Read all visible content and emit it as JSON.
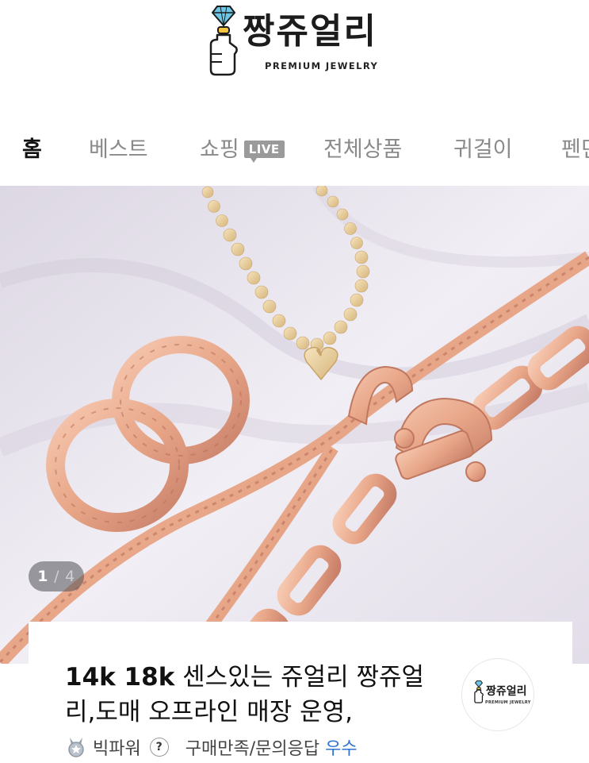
{
  "header": {
    "logo_title": "짱쥬얼리",
    "logo_subtitle": "PREMIUM JEWELRY"
  },
  "nav": {
    "items": [
      {
        "label": "홈",
        "active": true
      },
      {
        "label": "베스트",
        "active": false
      },
      {
        "label": "쇼핑",
        "active": false,
        "badge": "LIVE"
      },
      {
        "label": "전체상품",
        "active": false
      },
      {
        "label": "귀걸이",
        "active": false
      },
      {
        "label": "펜던트",
        "active": false
      }
    ]
  },
  "hero": {
    "page_current": "1",
    "page_separator": "/",
    "page_total": "4"
  },
  "card": {
    "title_bold": "14k 18k",
    "title_rest": " 센스있는 쥬얼리 짱쥬얼리,도매 오프라인 매장 운영,",
    "avatar_title": "짱쥬얼리",
    "avatar_subtitle": "PREMIUM JEWELRY",
    "badge_label": "빅파워",
    "help_symbol": "?",
    "rating_label": "구매만족/문의응답",
    "rating_value": "우수"
  },
  "colors": {
    "rating_value": "#2f74d0",
    "nav_active": "#111111",
    "nav_inactive": "#8a8a8a",
    "live_badge": "#9a9a9a",
    "rose_gold": "#e8a688"
  },
  "icons": [
    "diamond-thumb-logo-icon",
    "medal-icon",
    "help-icon"
  ]
}
